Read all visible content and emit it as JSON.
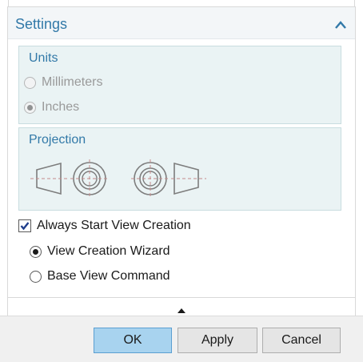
{
  "settings": {
    "title": "Settings",
    "collapse_icon": "chevron-up-icon",
    "accent_color": "#3279a8"
  },
  "units": {
    "title": "Units",
    "enabled": false,
    "options": [
      {
        "label": "Millimeters",
        "selected": false
      },
      {
        "label": "Inches",
        "selected": true
      }
    ]
  },
  "projection": {
    "title": "Projection",
    "options": [
      {
        "icon": "first-angle-projection-icon"
      },
      {
        "icon": "third-angle-projection-icon"
      }
    ]
  },
  "always_start": {
    "label": "Always Start View Creation",
    "checked": true
  },
  "creation_mode": {
    "options": [
      {
        "label": "View Creation Wizard",
        "selected": true
      },
      {
        "label": "Base View Command",
        "selected": false
      }
    ]
  },
  "expander": {
    "icon": "triangle-up-icon"
  },
  "buttons": {
    "ok": "OK",
    "apply": "Apply",
    "cancel": "Cancel",
    "primary_color": "#a8d3ef"
  }
}
